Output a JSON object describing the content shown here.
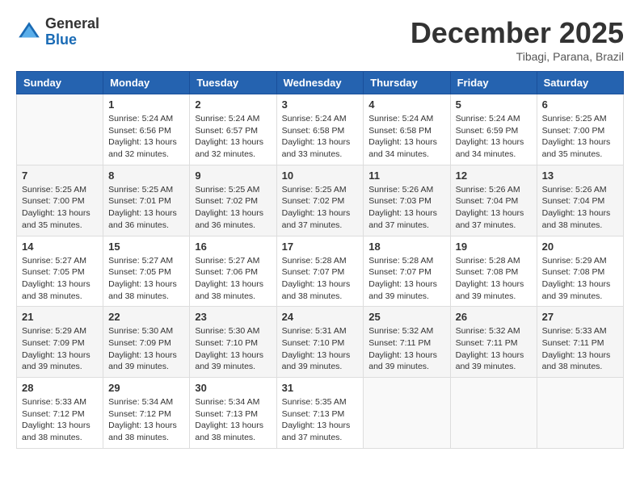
{
  "header": {
    "logo_general": "General",
    "logo_blue": "Blue",
    "month_title": "December 2025",
    "location": "Tibagi, Parana, Brazil"
  },
  "weekdays": [
    "Sunday",
    "Monday",
    "Tuesday",
    "Wednesday",
    "Thursday",
    "Friday",
    "Saturday"
  ],
  "weeks": [
    [
      {
        "day": "",
        "info": ""
      },
      {
        "day": "1",
        "info": "Sunrise: 5:24 AM\nSunset: 6:56 PM\nDaylight: 13 hours\nand 32 minutes."
      },
      {
        "day": "2",
        "info": "Sunrise: 5:24 AM\nSunset: 6:57 PM\nDaylight: 13 hours\nand 32 minutes."
      },
      {
        "day": "3",
        "info": "Sunrise: 5:24 AM\nSunset: 6:58 PM\nDaylight: 13 hours\nand 33 minutes."
      },
      {
        "day": "4",
        "info": "Sunrise: 5:24 AM\nSunset: 6:58 PM\nDaylight: 13 hours\nand 34 minutes."
      },
      {
        "day": "5",
        "info": "Sunrise: 5:24 AM\nSunset: 6:59 PM\nDaylight: 13 hours\nand 34 minutes."
      },
      {
        "day": "6",
        "info": "Sunrise: 5:25 AM\nSunset: 7:00 PM\nDaylight: 13 hours\nand 35 minutes."
      }
    ],
    [
      {
        "day": "7",
        "info": "Sunrise: 5:25 AM\nSunset: 7:00 PM\nDaylight: 13 hours\nand 35 minutes."
      },
      {
        "day": "8",
        "info": "Sunrise: 5:25 AM\nSunset: 7:01 PM\nDaylight: 13 hours\nand 36 minutes."
      },
      {
        "day": "9",
        "info": "Sunrise: 5:25 AM\nSunset: 7:02 PM\nDaylight: 13 hours\nand 36 minutes."
      },
      {
        "day": "10",
        "info": "Sunrise: 5:25 AM\nSunset: 7:02 PM\nDaylight: 13 hours\nand 37 minutes."
      },
      {
        "day": "11",
        "info": "Sunrise: 5:26 AM\nSunset: 7:03 PM\nDaylight: 13 hours\nand 37 minutes."
      },
      {
        "day": "12",
        "info": "Sunrise: 5:26 AM\nSunset: 7:04 PM\nDaylight: 13 hours\nand 37 minutes."
      },
      {
        "day": "13",
        "info": "Sunrise: 5:26 AM\nSunset: 7:04 PM\nDaylight: 13 hours\nand 38 minutes."
      }
    ],
    [
      {
        "day": "14",
        "info": "Sunrise: 5:27 AM\nSunset: 7:05 PM\nDaylight: 13 hours\nand 38 minutes."
      },
      {
        "day": "15",
        "info": "Sunrise: 5:27 AM\nSunset: 7:05 PM\nDaylight: 13 hours\nand 38 minutes."
      },
      {
        "day": "16",
        "info": "Sunrise: 5:27 AM\nSunset: 7:06 PM\nDaylight: 13 hours\nand 38 minutes."
      },
      {
        "day": "17",
        "info": "Sunrise: 5:28 AM\nSunset: 7:07 PM\nDaylight: 13 hours\nand 38 minutes."
      },
      {
        "day": "18",
        "info": "Sunrise: 5:28 AM\nSunset: 7:07 PM\nDaylight: 13 hours\nand 39 minutes."
      },
      {
        "day": "19",
        "info": "Sunrise: 5:28 AM\nSunset: 7:08 PM\nDaylight: 13 hours\nand 39 minutes."
      },
      {
        "day": "20",
        "info": "Sunrise: 5:29 AM\nSunset: 7:08 PM\nDaylight: 13 hours\nand 39 minutes."
      }
    ],
    [
      {
        "day": "21",
        "info": "Sunrise: 5:29 AM\nSunset: 7:09 PM\nDaylight: 13 hours\nand 39 minutes."
      },
      {
        "day": "22",
        "info": "Sunrise: 5:30 AM\nSunset: 7:09 PM\nDaylight: 13 hours\nand 39 minutes."
      },
      {
        "day": "23",
        "info": "Sunrise: 5:30 AM\nSunset: 7:10 PM\nDaylight: 13 hours\nand 39 minutes."
      },
      {
        "day": "24",
        "info": "Sunrise: 5:31 AM\nSunset: 7:10 PM\nDaylight: 13 hours\nand 39 minutes."
      },
      {
        "day": "25",
        "info": "Sunrise: 5:32 AM\nSunset: 7:11 PM\nDaylight: 13 hours\nand 39 minutes."
      },
      {
        "day": "26",
        "info": "Sunrise: 5:32 AM\nSunset: 7:11 PM\nDaylight: 13 hours\nand 39 minutes."
      },
      {
        "day": "27",
        "info": "Sunrise: 5:33 AM\nSunset: 7:11 PM\nDaylight: 13 hours\nand 38 minutes."
      }
    ],
    [
      {
        "day": "28",
        "info": "Sunrise: 5:33 AM\nSunset: 7:12 PM\nDaylight: 13 hours\nand 38 minutes."
      },
      {
        "day": "29",
        "info": "Sunrise: 5:34 AM\nSunset: 7:12 PM\nDaylight: 13 hours\nand 38 minutes."
      },
      {
        "day": "30",
        "info": "Sunrise: 5:34 AM\nSunset: 7:13 PM\nDaylight: 13 hours\nand 38 minutes."
      },
      {
        "day": "31",
        "info": "Sunrise: 5:35 AM\nSunset: 7:13 PM\nDaylight: 13 hours\nand 37 minutes."
      },
      {
        "day": "",
        "info": ""
      },
      {
        "day": "",
        "info": ""
      },
      {
        "day": "",
        "info": ""
      }
    ]
  ]
}
